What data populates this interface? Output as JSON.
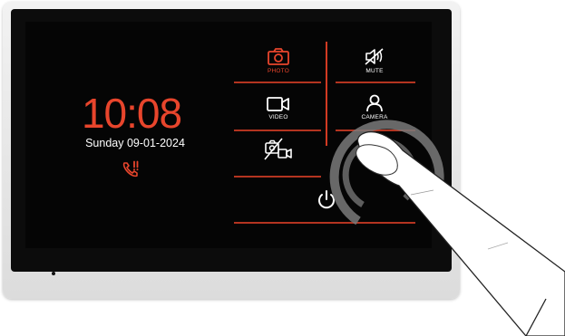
{
  "clock": {
    "time": "10:08",
    "day": "Sunday",
    "date": "09-01-2024",
    "display": "Sunday  09-01-2024"
  },
  "menu": {
    "photo_label": "PHOTO",
    "mute_label": "MUTE",
    "video_label": "VIDEO",
    "camera_label": "CAMERA"
  },
  "colors": {
    "accent": "#e8452c",
    "text": "#ffffff",
    "screen": "#050505",
    "bezel": "#0c0c0c"
  },
  "icons": {
    "alert": "phone-alert-icon",
    "photo": "camera-photo-icon",
    "mute": "speaker-mute-icon",
    "video": "video-camera-icon",
    "camera": "person-icon",
    "camera_off": "camera-off-video-icon",
    "power": "power-icon"
  }
}
